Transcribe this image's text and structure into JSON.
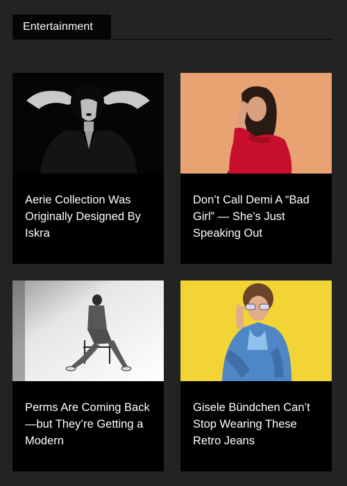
{
  "section": {
    "title": "Entertainment"
  },
  "articles": [
    {
      "title": "Aerie Collection Was Originally Designed By Iskra",
      "image": "woman-black-white-portrait"
    },
    {
      "title": "Don’t Call Demi A “Bad Girl” — She’s Just Speaking Out",
      "image": "woman-red-top-orange-backdrop"
    },
    {
      "title": "Perms Are Coming Back—but They’re Getting a Modern",
      "image": "seated-figure-white-studio"
    },
    {
      "title": "Gisele Bündchen Can’t Stop Wearing These Retro Jeans",
      "image": "man-sunglasses-yellow-backdrop"
    }
  ],
  "colors": {
    "page_background": "#222325",
    "tab_background": "#050505",
    "card_background": "#000000",
    "text": "#ffffff"
  }
}
